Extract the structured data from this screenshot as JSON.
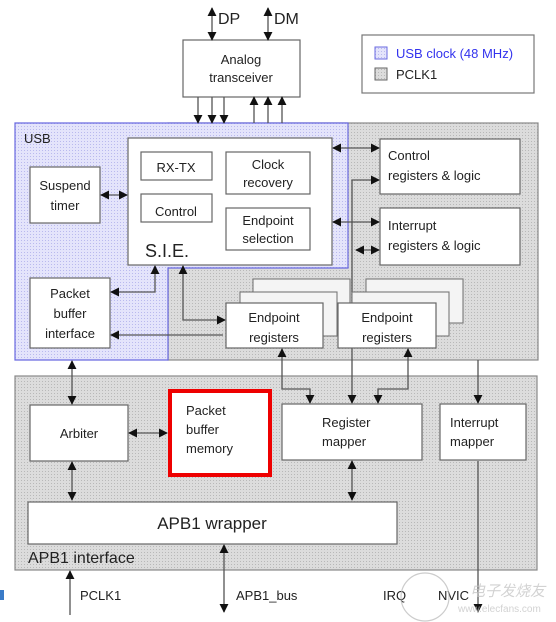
{
  "external_signals": {
    "dp": "DP",
    "dm": "DM",
    "pclk1": "PCLK1",
    "apb1_bus": "APB1_bus",
    "irq": "IRQ",
    "nvic": "NVIC"
  },
  "legend": {
    "items": [
      {
        "label": "USB clock (48 MHz)",
        "color": "#3333ee",
        "swatch": "#d0d0f8"
      },
      {
        "label": "PCLK1",
        "color": "#222222",
        "swatch": "#cfcfcf"
      }
    ]
  },
  "regions": {
    "usb": "USB",
    "apb1_interface": "APB1 interface"
  },
  "blocks": {
    "analog_transceiver": [
      "Analog",
      "transceiver"
    ],
    "suspend_timer": [
      "Suspend",
      "timer"
    ],
    "sie_label": "S.I.E.",
    "rx_tx": "RX-TX",
    "control": "Control",
    "clock_recovery": [
      "Clock",
      "recovery"
    ],
    "endpoint_selection": [
      "Endpoint",
      "selection"
    ],
    "packet_buffer_interface": [
      "Packet",
      "buffer",
      "interface"
    ],
    "control_registers": [
      "Control",
      "registers & logic"
    ],
    "interrupt_registers": [
      "Interrupt",
      "registers & logic"
    ],
    "endpoint_registers_1": [
      "Endpoint",
      "registers"
    ],
    "endpoint_registers_2": [
      "Endpoint",
      "registers"
    ],
    "arbiter": "Arbiter",
    "packet_buffer_memory": [
      "Packet",
      "buffer",
      "memory"
    ],
    "register_mapper": [
      "Register",
      "mapper"
    ],
    "interrupt_mapper": [
      "Interrupt",
      "mapper"
    ],
    "apb1_wrapper": "APB1 wrapper"
  },
  "highlight": {
    "block": "packet_buffer_memory",
    "color": "#ee0000"
  },
  "watermark": {
    "text": "电子发烧友",
    "url_text": "www.elecfans.com"
  }
}
